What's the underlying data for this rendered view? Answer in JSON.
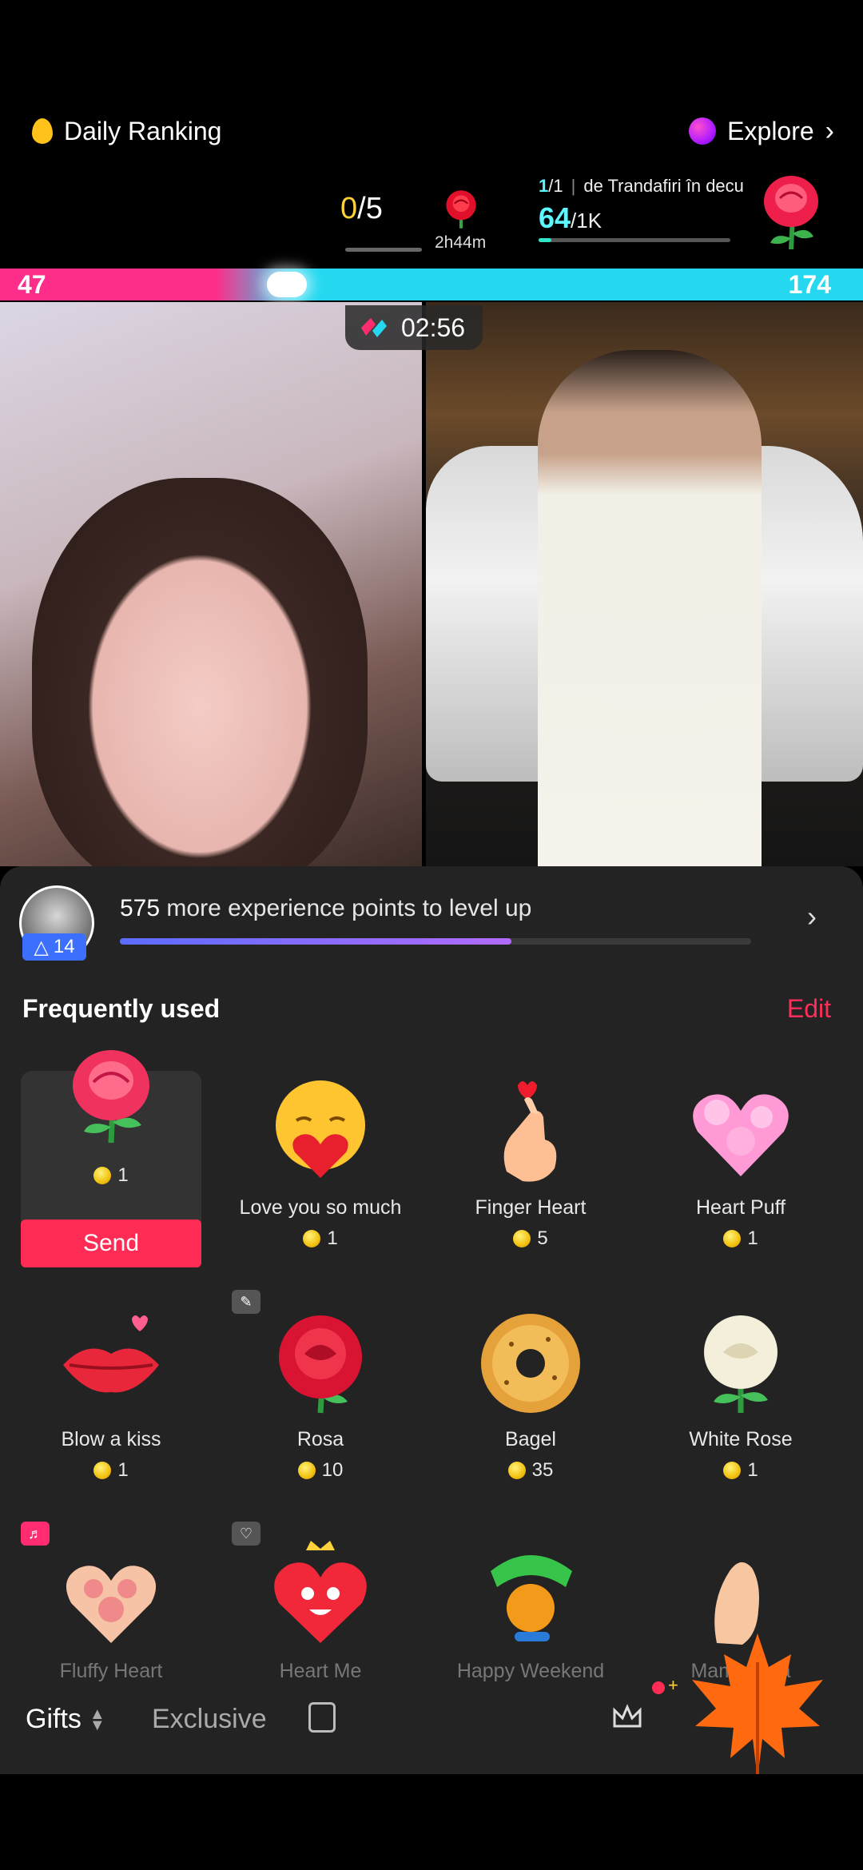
{
  "top": {
    "daily_ranking": "Daily Ranking",
    "explore": "Explore"
  },
  "goal": {
    "done": "0",
    "total": "/5",
    "time_left": "2h44m",
    "stage_current": "1",
    "stage_total": "/1",
    "stage_name": "de Trandafiri în decu",
    "score": "64",
    "score_target": "/1K"
  },
  "battle": {
    "left_score": "47",
    "right_score": "174",
    "timer": "02:56"
  },
  "level": {
    "badge": "14",
    "xp_number": "575",
    "xp_text": " more experience points to level up",
    "progress": 0.62
  },
  "panel": {
    "frequently_used": "Frequently used",
    "edit": "Edit",
    "send": "Send"
  },
  "gifts_row1": [
    {
      "name": "",
      "price": "1",
      "icon": "rose-icon"
    },
    {
      "name": "Love you so much",
      "price": "1",
      "icon": "hug-heart-icon"
    },
    {
      "name": "Finger Heart",
      "price": "5",
      "icon": "finger-heart-icon"
    },
    {
      "name": "Heart Puff",
      "price": "1",
      "icon": "heart-puff-icon"
    }
  ],
  "gifts_row2": [
    {
      "name": "Blow a kiss",
      "price": "1",
      "icon": "lips-icon"
    },
    {
      "name": "Rosa",
      "price": "10",
      "icon": "rosa-icon"
    },
    {
      "name": "Bagel",
      "price": "35",
      "icon": "bagel-icon"
    },
    {
      "name": "White Rose",
      "price": "1",
      "icon": "white-rose-icon"
    }
  ],
  "gifts_row3": [
    {
      "name": "Fluffy Heart",
      "icon": "fluffy-heart-icon"
    },
    {
      "name": "Heart Me",
      "icon": "heart-me-icon"
    },
    {
      "name": "Happy Weekend",
      "icon": "happy-weekend-icon"
    },
    {
      "name": "Mamma...a",
      "icon": "hand-icon"
    }
  ],
  "bottom": {
    "gifts_tab": "Gifts",
    "exclusive_tab": "Exclusive"
  },
  "colors": {
    "accent_red": "#fe2c55",
    "battle_pink": "#ff2d8a",
    "battle_cyan": "#25d8f0",
    "panel_bg": "#232323"
  }
}
